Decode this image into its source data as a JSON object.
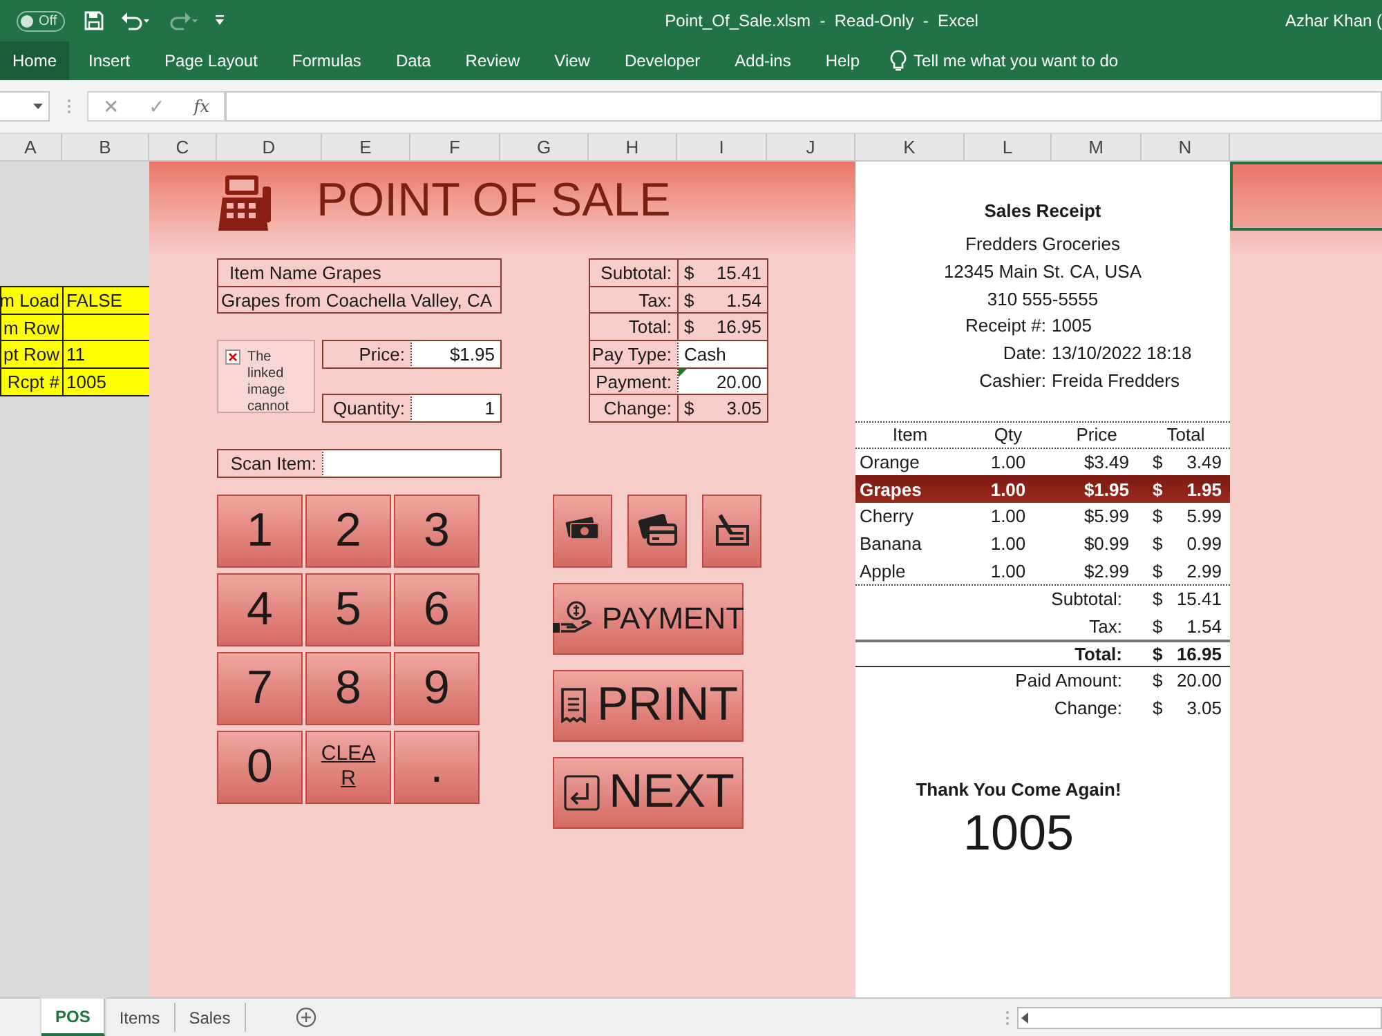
{
  "window": {
    "title": "Point_Of_Sale.xlsm  -  Read-Only  -  Excel",
    "user": "Azhar Khan (",
    "autosave": {
      "label": "Off",
      "on": false
    }
  },
  "ribbon_tabs": [
    {
      "label": "Home",
      "selected": true
    },
    {
      "label": "Insert",
      "selected": false
    },
    {
      "label": "Page Layout",
      "selected": false
    },
    {
      "label": "Formulas",
      "selected": false
    },
    {
      "label": "Data",
      "selected": false
    },
    {
      "label": "Review",
      "selected": false
    },
    {
      "label": "View",
      "selected": false
    },
    {
      "label": "Developer",
      "selected": false
    },
    {
      "label": "Add-ins",
      "selected": false
    },
    {
      "label": "Help",
      "selected": false
    }
  ],
  "tell_me": "Tell me what you want to do",
  "formula_bar": {
    "cancel": "✕",
    "enter": "✓",
    "insert_function": "fx"
  },
  "column_headers": [
    "A",
    "B",
    "C",
    "D",
    "E",
    "F",
    "G",
    "H",
    "I",
    "J",
    "K",
    "L",
    "M",
    "N"
  ],
  "sheet": {
    "variables": [
      {
        "label": "m Load",
        "value": "FALSE"
      },
      {
        "label": "m Row"
      },
      {
        "label": "pt Row",
        "value": "11"
      },
      {
        "label": "Rcpt #",
        "value": "1005"
      }
    ],
    "title": "POINT OF SALE",
    "item_name": "Item Name Grapes",
    "item_description": "Grapes from Coachella Valley, CA",
    "broken_image": "The linked image cannot",
    "price": {
      "label": "Price:",
      "value": "$1.95"
    },
    "quantity": {
      "label": "Quantity:",
      "value": "1"
    },
    "scan_item": {
      "label": "Scan Item:"
    },
    "summary": [
      {
        "label": "Subtotal:",
        "kind": "amount",
        "currency": "$",
        "value": "15.41"
      },
      {
        "label": "Tax:",
        "kind": "amount",
        "currency": "$",
        "value": "1.54"
      },
      {
        "label": "Total:",
        "kind": "amount",
        "currency": "$",
        "value": "16.95"
      },
      {
        "label": "Pay Type:",
        "kind": "choice",
        "value": "Cash"
      },
      {
        "label": "Payment:",
        "kind": "entry",
        "value": "20.00"
      },
      {
        "label": "Change:",
        "kind": "amount",
        "currency": "$",
        "value": "3.05"
      }
    ],
    "keypad": [
      "1",
      "2",
      "3",
      "4",
      "5",
      "6",
      "7",
      "8",
      "9",
      "0",
      "CLEAR",
      "."
    ],
    "payment_methods": [
      {
        "kind": "cash"
      },
      {
        "kind": "card"
      },
      {
        "kind": "check"
      }
    ],
    "actions": [
      {
        "kind": "payment",
        "label": "PAYMENT"
      },
      {
        "kind": "print",
        "label": "PRINT"
      },
      {
        "kind": "next",
        "label": "NEXT"
      }
    ]
  },
  "receipt": {
    "title": "Sales Receipt",
    "store": "Fredders Groceries",
    "address": "12345 Main St. CA, USA",
    "phone": "310 555-5555",
    "info": [
      {
        "label": "Receipt #:",
        "value": "1005"
      },
      {
        "label": "Date:",
        "value": "13/10/2022 18:18"
      },
      {
        "label": "Cashier:",
        "value": "Freida Fredders"
      }
    ],
    "columns": [
      "Item",
      "Qty",
      "Price",
      "Total"
    ],
    "lines": [
      {
        "item": "Orange",
        "qty": "1.00",
        "price": "$3.49",
        "currency": "$",
        "total": "3.49",
        "selected": false
      },
      {
        "item": "Grapes",
        "qty": "1.00",
        "price": "$1.95",
        "currency": "$",
        "total": "1.95",
        "selected": true
      },
      {
        "item": "Cherry",
        "qty": "1.00",
        "price": "$5.99",
        "currency": "$",
        "total": "5.99",
        "selected": false
      },
      {
        "item": "Banana",
        "qty": "1.00",
        "price": "$0.99",
        "currency": "$",
        "total": "0.99",
        "selected": false
      },
      {
        "item": "Apple",
        "qty": "1.00",
        "price": "$2.99",
        "currency": "$",
        "total": "2.99",
        "selected": false
      }
    ],
    "totals": [
      {
        "label": "Subtotal:",
        "kind": "normal",
        "currency": "$",
        "value": "15.41"
      },
      {
        "label": "Tax:",
        "kind": "normal",
        "currency": "$",
        "value": "1.54"
      },
      {
        "label": "Total:",
        "kind": "grand",
        "currency": "$",
        "value": "16.95"
      },
      {
        "label": "Paid Amount:",
        "kind": "normal",
        "currency": "$",
        "value": "20.00"
      },
      {
        "label": "Change:",
        "kind": "normal",
        "currency": "$",
        "value": "3.05"
      }
    ],
    "footer": "Thank You Come Again!",
    "number": "1005"
  },
  "sheet_tabs": [
    {
      "label": "POS",
      "selected": true
    },
    {
      "label": "Items",
      "selected": false
    },
    {
      "label": "Sales",
      "selected": false
    }
  ]
}
